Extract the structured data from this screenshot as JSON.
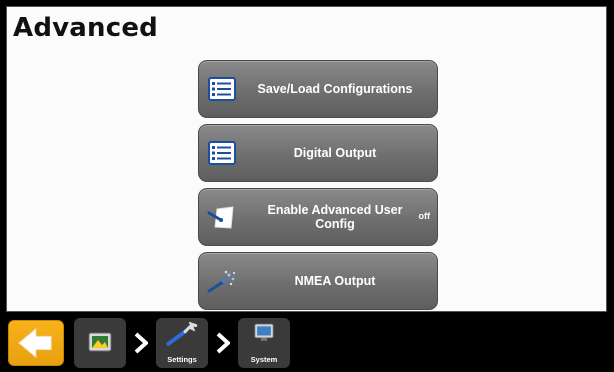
{
  "page": {
    "title": "Advanced"
  },
  "menu": {
    "items": [
      {
        "label": "Save/Load Configurations",
        "icon": "list-icon"
      },
      {
        "label": "Digital Output",
        "icon": "list-icon"
      },
      {
        "label": "Enable Advanced User Config",
        "icon": "user-config-icon",
        "state": "off"
      },
      {
        "label": "NMEA Output",
        "icon": "satellite-output-icon"
      }
    ]
  },
  "taskbar": {
    "back_icon": "back-arrow-icon",
    "crumbs": [
      {
        "label": "",
        "icon": "home-screen-icon"
      },
      {
        "label": "Settings",
        "icon": "wrench-icon"
      },
      {
        "label": "System",
        "icon": "monitor-icon"
      }
    ]
  },
  "colors": {
    "accent": "#f4a81c",
    "button": "#707070",
    "background": "#fbfbfb",
    "taskbar": "#000000"
  }
}
